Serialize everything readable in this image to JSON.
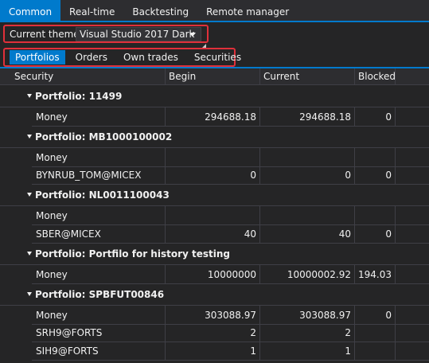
{
  "top_tabs": [
    "Common",
    "Real-time",
    "Backtesting",
    "Remote manager"
  ],
  "theme": {
    "label": "Current theme",
    "value": "Visual Studio 2017 Dark"
  },
  "sub_tabs": [
    "Portfolios",
    "Orders",
    "Own trades",
    "Securities"
  ],
  "grid": {
    "columns": [
      "Security",
      "Begin",
      "Current",
      "Blocked"
    ],
    "groups": [
      {
        "title": "Portfolio: 11499",
        "rows": [
          {
            "security": "Money",
            "begin": "294688.18",
            "current": "294688.18",
            "blocked": "0"
          }
        ]
      },
      {
        "title": "Portfolio: MB1000100002",
        "rows": [
          {
            "security": "Money",
            "begin": "",
            "current": "",
            "blocked": ""
          },
          {
            "security": "BYNRUB_TOM@MICEX",
            "begin": "0",
            "current": "0",
            "blocked": "0"
          }
        ]
      },
      {
        "title": "Portfolio: NL0011100043",
        "rows": [
          {
            "security": "Money",
            "begin": "",
            "current": "",
            "blocked": ""
          },
          {
            "security": "SBER@MICEX",
            "begin": "40",
            "current": "40",
            "blocked": "0"
          }
        ]
      },
      {
        "title": "Portfolio: Portfilo for history testing",
        "rows": [
          {
            "security": "Money",
            "begin": "10000000",
            "current": "10000002.92",
            "blocked": "194.03"
          }
        ]
      },
      {
        "title": "Portfolio: SPBFUT00846",
        "rows": [
          {
            "security": "Money",
            "begin": "303088.97",
            "current": "303088.97",
            "blocked": "0"
          },
          {
            "security": "SRH9@FORTS",
            "begin": "2",
            "current": "2",
            "blocked": ""
          },
          {
            "security": "SIH9@FORTS",
            "begin": "1",
            "current": "1",
            "blocked": ""
          }
        ]
      }
    ]
  }
}
